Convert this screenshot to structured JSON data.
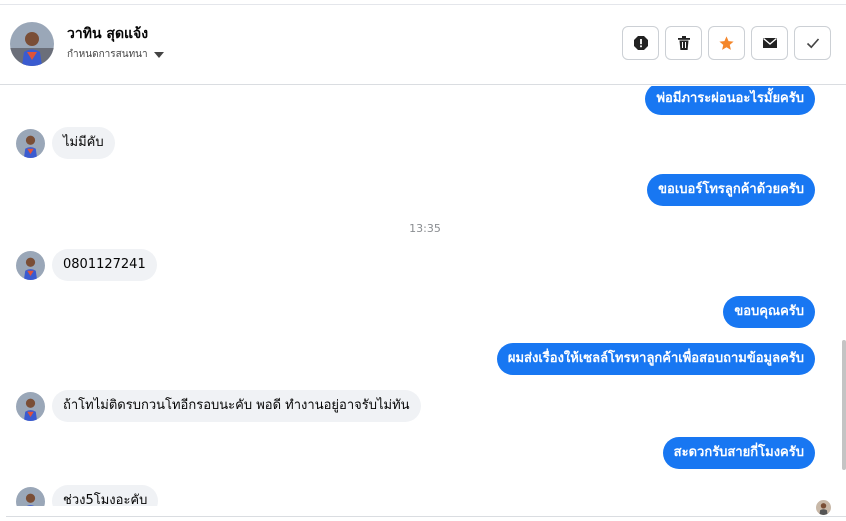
{
  "contact": {
    "name": "วาทิน สุดแจ้ง",
    "label_menu": "กำหนดการสนทนา"
  },
  "actions": [
    {
      "icon": "alert-icon",
      "name": "report-button"
    },
    {
      "icon": "trash-icon",
      "name": "delete-button"
    },
    {
      "icon": "star-icon",
      "name": "star-button"
    },
    {
      "icon": "envelope-icon",
      "name": "mark-unread-button"
    },
    {
      "icon": "check-icon",
      "name": "mark-done-button"
    }
  ],
  "messages": {
    "m1": "พ่อมีภาระผ่อนอะไรมั้ยครับ",
    "m2": "ไม่มีคับ",
    "m3": "ขอเบอร์โทรลูกค้าด้วยครับ",
    "time1": "13:35",
    "m4": "0801127241",
    "m5": "ขอบคุณครับ",
    "m6": "ผมส่งเรื่องให้เซลล์โทรหาลูกค้าเพื่อสอบถามข้อมูลครับ",
    "m7": "ถ้าโทไม่ติดรบกวนโทอีกรอบนะคับ พอดี ทำงานอยู่อาจรับไม่ทัน",
    "m8": "สะดวกรับสายกี่โมงครับ",
    "m9": "ช่วง5โมงอะคับ"
  },
  "colors": {
    "outgoing_bubble": "#1877f2",
    "incoming_bubble": "#f0f2f5",
    "star": "#f4862a"
  }
}
